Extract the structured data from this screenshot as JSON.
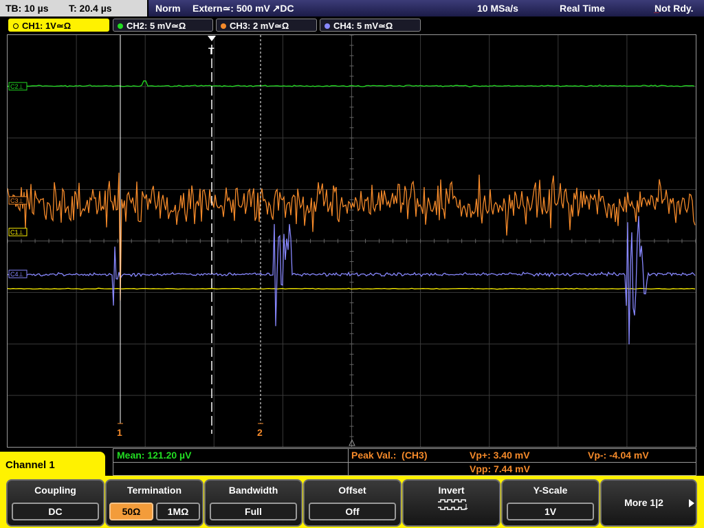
{
  "status": {
    "tb_label": "TB: 10 µs",
    "t_label": "T: 20.4 µs",
    "trigger_mode": "Norm",
    "trigger_source": "Extern≃: 500 mV ↗DC",
    "sample_rate": "10 MSa/s",
    "acq_mode": "Real Time",
    "ready_state": "Not Rdy."
  },
  "channels": [
    {
      "label": "CH1: 1V≃Ω",
      "color": "#fff200"
    },
    {
      "label": "CH2: 5 mV≃Ω",
      "color": "#22dd22"
    },
    {
      "label": "CH3: 2 mV≃Ω",
      "color": "#f58a2a"
    },
    {
      "label": "CH4: 5 mV≃Ω",
      "color": "#8888ff"
    }
  ],
  "markers": {
    "ch2": "C2⊥",
    "ch3": "C3⊥",
    "ch1": "C1⊥",
    "ch4": "C4⊥",
    "trigger": "T",
    "cursor1": "1",
    "cursor2": "2"
  },
  "measurements": {
    "mean": "Mean: 121.20 µV",
    "peak_label": "Peak Val.:  (CH3)",
    "vp_plus": "Vp+: 3.40 mV",
    "vp_minus": "Vp-: -4.04 mV",
    "vpp": "Vpp: 7.44 mV"
  },
  "menu_title": "Channel 1",
  "softkeys": {
    "coupling": {
      "title": "Coupling",
      "value": "DC"
    },
    "termination": {
      "title": "Termination",
      "option_a": "50Ω",
      "option_b": "1MΩ",
      "selected": "50Ω"
    },
    "bandwidth": {
      "title": "Bandwidth",
      "value": "Full"
    },
    "offset": {
      "title": "Offset",
      "value": "Off"
    },
    "invert": {
      "title": "Invert",
      "icon": "inverted-square-wave-icon"
    },
    "yscale": {
      "title": "Y-Scale",
      "value": "1V"
    },
    "more": {
      "title": "More 1|2"
    }
  },
  "colors": {
    "ch1": "#fff200",
    "ch2": "#22dd22",
    "ch3": "#f58a2a",
    "ch4": "#8888ff",
    "softkey_bar": "#fff200",
    "status_bar": "#2c2c60"
  }
}
